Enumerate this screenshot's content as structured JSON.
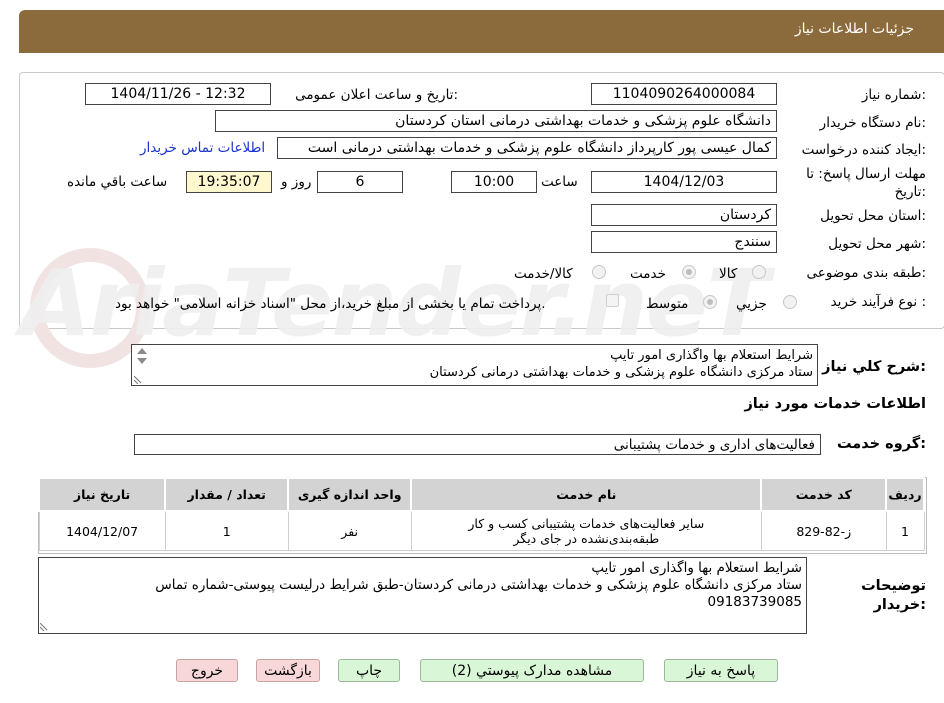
{
  "header": {
    "title": "جزئیات اطلاعات نیاز"
  },
  "form": {
    "need_number_label": "شماره نیاز:",
    "need_number": "1104090264000084",
    "announce_label": "تاریخ و ساعت اعلان عمومی:",
    "announce_value": "1404/11/26 - 12:32",
    "buyer_org_label": "نام دستگاه خریدار:",
    "buyer_org": "دانشگاه علوم پزشکی و خدمات بهداشتی  درمانی استان کردستان",
    "creator_label": "ایجاد کننده درخواست:",
    "creator": "کمال عیسی پور کارپرداز دانشگاه علوم پزشکی و خدمات بهداشتی  درمانی است",
    "contact_link": "اطلاعات تماس خریدار",
    "deadline_label_1": "مهلت ارسال پاسخ: تا",
    "deadline_label_2": "تاریخ:",
    "deadline_date": "1404/12/03",
    "hour_label": "ساعت",
    "deadline_time": "10:00",
    "days": "6",
    "days_label": "روز و",
    "remaining_time": "19:35:07",
    "remaining_label": "ساعت باقي مانده",
    "province_label": "استان محل تحویل:",
    "province": "کردستان",
    "city_label": "شهر محل تحویل:",
    "city": "سنندج",
    "category_label": "طبقه بندی موضوعی:",
    "category_options": [
      "کالا",
      "خدمت",
      "کالا/خدمت"
    ],
    "category_selected": "خدمت",
    "process_label": "نوع فرآیند خرید :",
    "process_options": [
      "جزیي",
      "متوسط"
    ],
    "process_selected": "متوسط",
    "payment_note": "پرداخت تمام یا بخشی از مبلغ خرید،از محل \"اسناد خزانه اسلامی\" خواهد بود."
  },
  "description": {
    "label": "شرح کلي نیاز:",
    "line1": "شرایط استعلام بها واگذاری امور تایپ",
    "line2": "ستاد مرکزی دانشگاه علوم پزشکی و خدمات بهداشتی درمانی کردستان"
  },
  "services": {
    "section_title": "اطلاعات خدمات مورد نیاز",
    "group_label": "گروه خدمت:",
    "group_value": "فعالیت‌های اداری و خدمات پشتیبانی",
    "columns": [
      "ردیف",
      "کد خدمت",
      "نام خدمت",
      "واحد اندازه گیری",
      "تعداد / مقدار",
      "تاریخ نیاز"
    ],
    "rows": [
      {
        "index": "1",
        "code": "ز-82-829",
        "name_line1": "سایر فعالیت‌های خدمات پشتیبانی کسب و کار",
        "name_line2": "طبقه‌بندی‌نشده در جای دیگر",
        "unit": "نفر",
        "qty": "1",
        "date": "1404/12/07"
      }
    ]
  },
  "buyer_notes": {
    "label_1": "توضیحات",
    "label_2": "خریدار:",
    "line1": "شرایط استعلام بها واگذاری امور تایپ",
    "line2": "ستاد مرکزی دانشگاه علوم پزشکی و خدمات بهداشتی درمانی کردستان-طبق شرایط درلیست پیوستی-شماره تماس",
    "line3": "09183739085"
  },
  "buttons": {
    "reply": "پاسخ به نیاز",
    "attachments": "مشاهده مدارک پیوستي (2)",
    "print": "چاپ",
    "back": "بازگشت",
    "exit": "خروج"
  },
  "watermark": "AriaTender.neT"
}
